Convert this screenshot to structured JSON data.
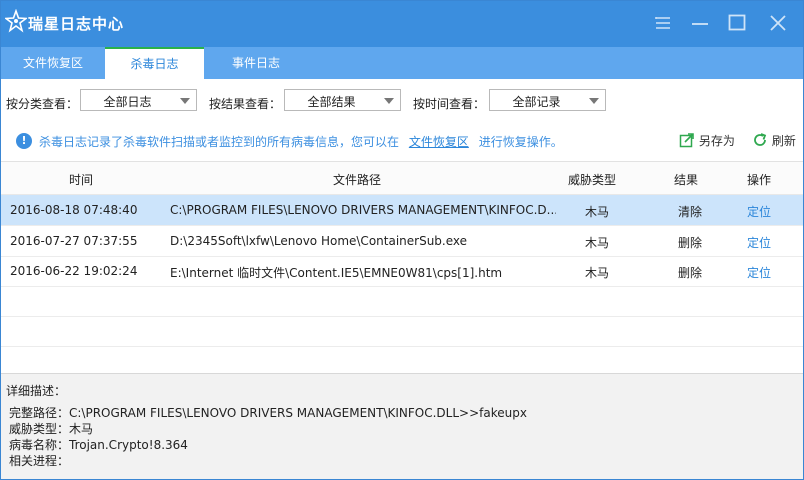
{
  "app": {
    "title": "瑞星日志中心",
    "accent": "#3b8ede",
    "tab_bar_color": "#5fa7ee"
  },
  "window_controls": [
    "list-icon",
    "minimize-icon",
    "maximize-icon",
    "close-icon"
  ],
  "tabs": [
    {
      "label": "文件恢复区",
      "active": false
    },
    {
      "label": "杀毒日志",
      "active": true
    },
    {
      "label": "事件日志",
      "active": false
    }
  ],
  "filters": {
    "category": {
      "label": "按分类查看：",
      "value": "全部日志"
    },
    "result": {
      "label": "按结果查看：",
      "value": "全部结果"
    },
    "time": {
      "label": "按时间查看：",
      "value": "全部记录"
    }
  },
  "info": {
    "text_before": "杀毒日志记录了杀毒软件扫描或者监控到的所有病毒信息，您可以在",
    "link": "文件恢复区",
    "text_after": "进行恢复操作。",
    "save_as": "另存为",
    "refresh": "刷新"
  },
  "table": {
    "columns": [
      "时间",
      "文件路径",
      "威胁类型",
      "结果",
      "操作"
    ],
    "rows": [
      {
        "time": "2016-08-18 07:48:40",
        "path": "C:\\PROGRAM FILES\\LENOVO DRIVERS MANAGEMENT\\KINFOC.D...",
        "type": "木马",
        "result": "清除",
        "op": "定位",
        "selected": true
      },
      {
        "time": "2016-07-27 07:37:55",
        "path": "D:\\2345Soft\\lxfw\\Lenovo Home\\ContainerSub.exe",
        "type": "木马",
        "result": "删除",
        "op": "定位",
        "selected": false
      },
      {
        "time": "2016-06-22 19:02:24",
        "path": "E:\\Internet 临时文件\\Content.IE5\\EMNE0W81\\cps[1].htm",
        "type": "木马",
        "result": "删除",
        "op": "定位",
        "selected": false
      }
    ]
  },
  "detail": {
    "heading": "详细描述：",
    "full_path": "完整路径：C:\\PROGRAM FILES\\LENOVO DRIVERS MANAGEMENT\\KINFOC.DLL>>fakeupx",
    "threat_type": "威胁类型：木马",
    "virus_name": "病毒名称：Trojan.Crypto!8.364",
    "process": "相关进程："
  }
}
